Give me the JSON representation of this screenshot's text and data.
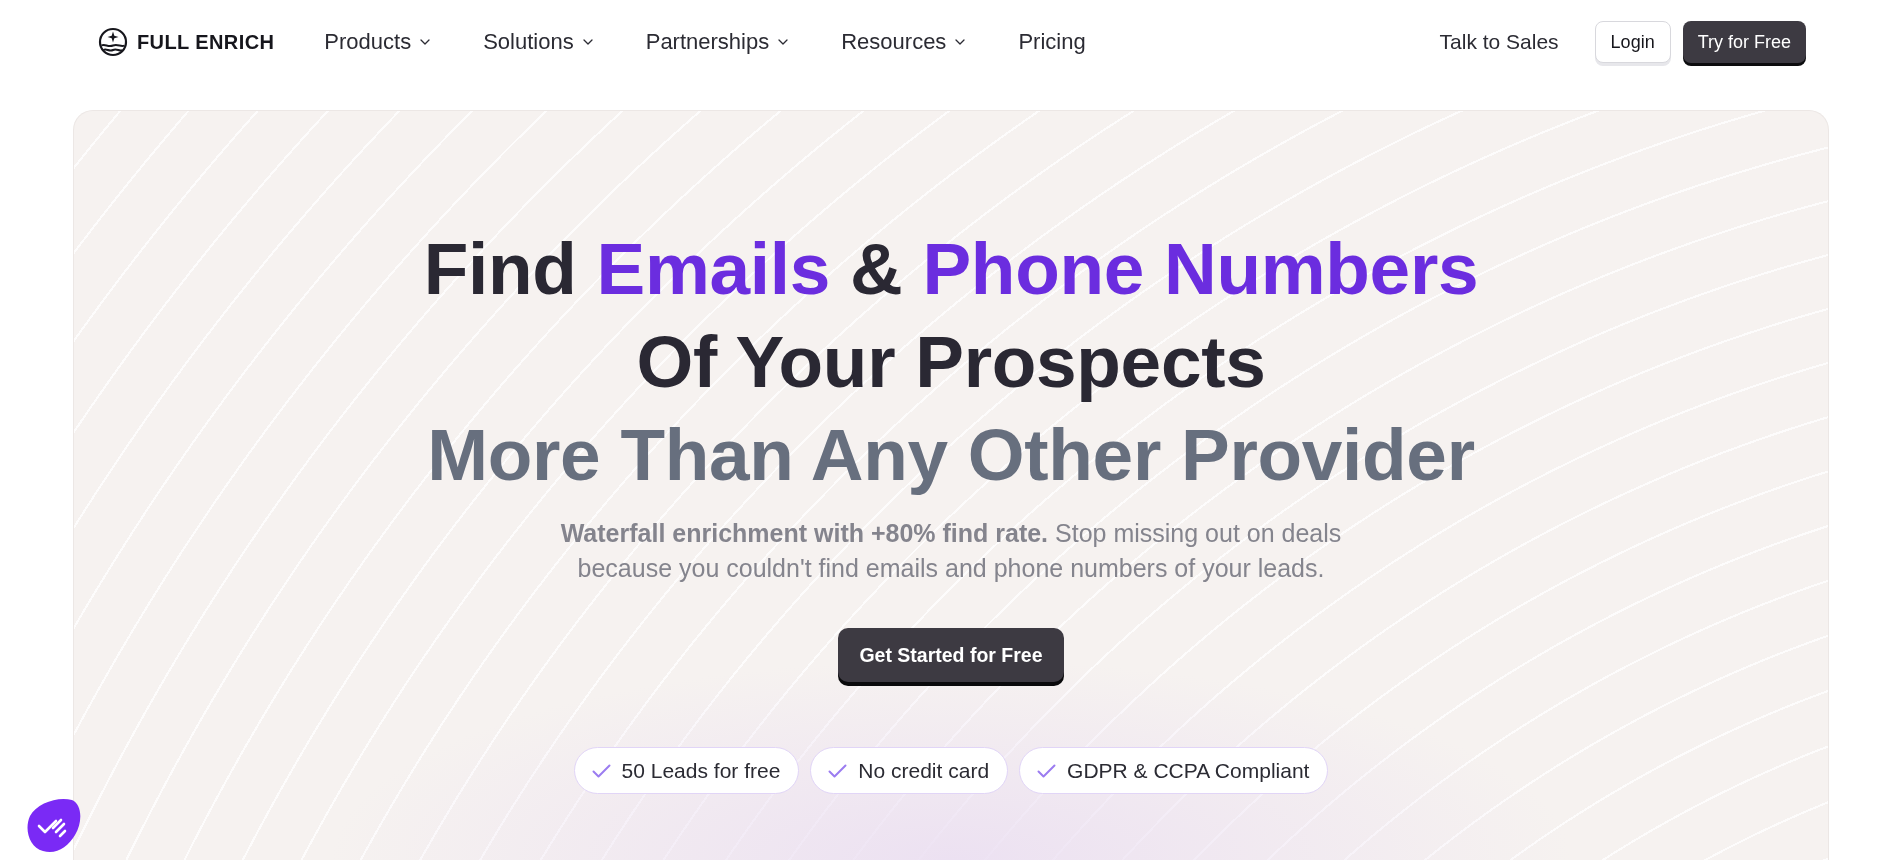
{
  "header": {
    "logo": "FULL ENRICH",
    "nav": [
      {
        "label": "Products",
        "has_menu": true
      },
      {
        "label": "Solutions",
        "has_menu": true
      },
      {
        "label": "Partnerships",
        "has_menu": true
      },
      {
        "label": "Resources",
        "has_menu": true
      },
      {
        "label": "Pricing",
        "has_menu": false
      }
    ],
    "actions": [
      {
        "label": "Talk to Sales",
        "kind": "link"
      },
      {
        "label": "Login",
        "kind": "outline"
      },
      {
        "label": "Try for Free",
        "kind": "primary"
      }
    ]
  },
  "hero": {
    "headline": [
      {
        "segments": [
          {
            "text": "Find",
            "highlight": false
          },
          {
            "text": "Emails",
            "highlight": true
          },
          {
            "text": "&",
            "highlight": false
          },
          {
            "text": "Phone Numbers",
            "highlight": true
          }
        ]
      },
      {
        "segments": [
          {
            "text": "Of Your Prospects",
            "highlight": false
          }
        ]
      }
    ],
    "tagline": "More Than Any Other Provider",
    "description": "**Waterfall enrichment with +80% find rate.** Stop missing out on deals because you couldn't find emails and phone numbers of your leads.",
    "cta": "Get Started for Free",
    "badges": [
      {
        "label": "50 Leads for free"
      },
      {
        "label": "No credit card"
      },
      {
        "label": "GDPR & CCPA Compliant"
      }
    ]
  }
}
